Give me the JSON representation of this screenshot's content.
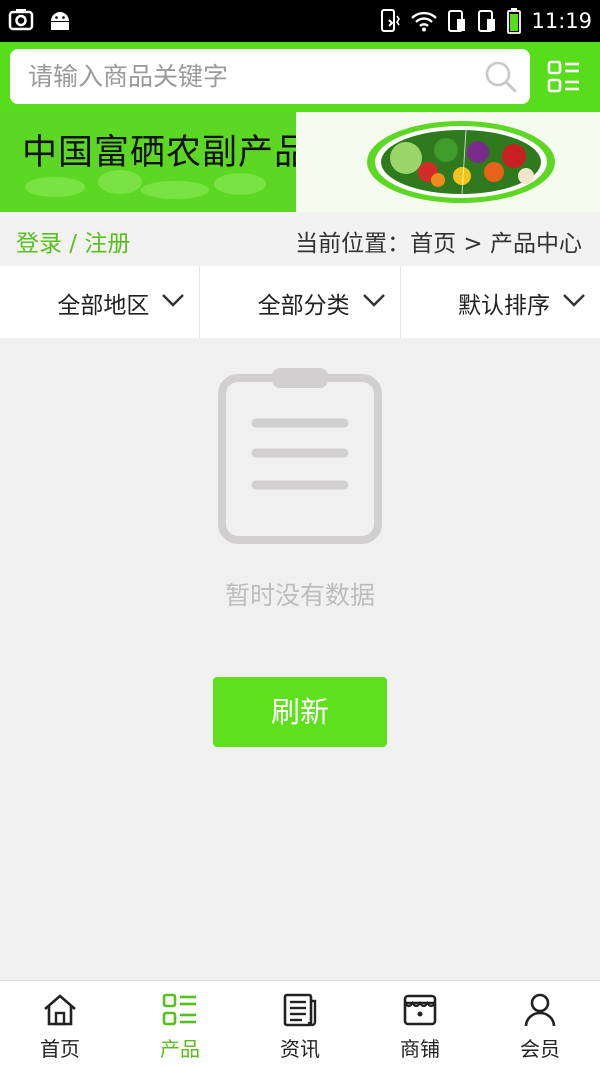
{
  "status_bar": {
    "time": "11:19",
    "icons": [
      "screenshot-icon",
      "android-icon",
      "phone-vibrate-icon",
      "wifi-icon",
      "sim1-icon",
      "sim2-icon",
      "battery-icon"
    ]
  },
  "search": {
    "placeholder": "请输入商品关键字",
    "value": ""
  },
  "banner": {
    "title": "中国富硒农副产品"
  },
  "crumb": {
    "login": "登录 / 注册",
    "location": "当前位置：首页 > 产品中心"
  },
  "filters": [
    {
      "label": "全部地区"
    },
    {
      "label": "全部分类"
    },
    {
      "label": "默认排序"
    }
  ],
  "empty": {
    "message": "暂时没有数据",
    "refresh_label": "刷新"
  },
  "tabs": [
    {
      "label": "首页",
      "icon": "home-icon",
      "active": false
    },
    {
      "label": "产品",
      "icon": "product-list-icon",
      "active": true
    },
    {
      "label": "资讯",
      "icon": "news-icon",
      "active": false
    },
    {
      "label": "商铺",
      "icon": "store-icon",
      "active": false
    },
    {
      "label": "会员",
      "icon": "user-icon",
      "active": false
    }
  ],
  "colors": {
    "brand_green": "#57dd1b",
    "active_green": "#57c01c",
    "button_green": "#5fe01c"
  }
}
